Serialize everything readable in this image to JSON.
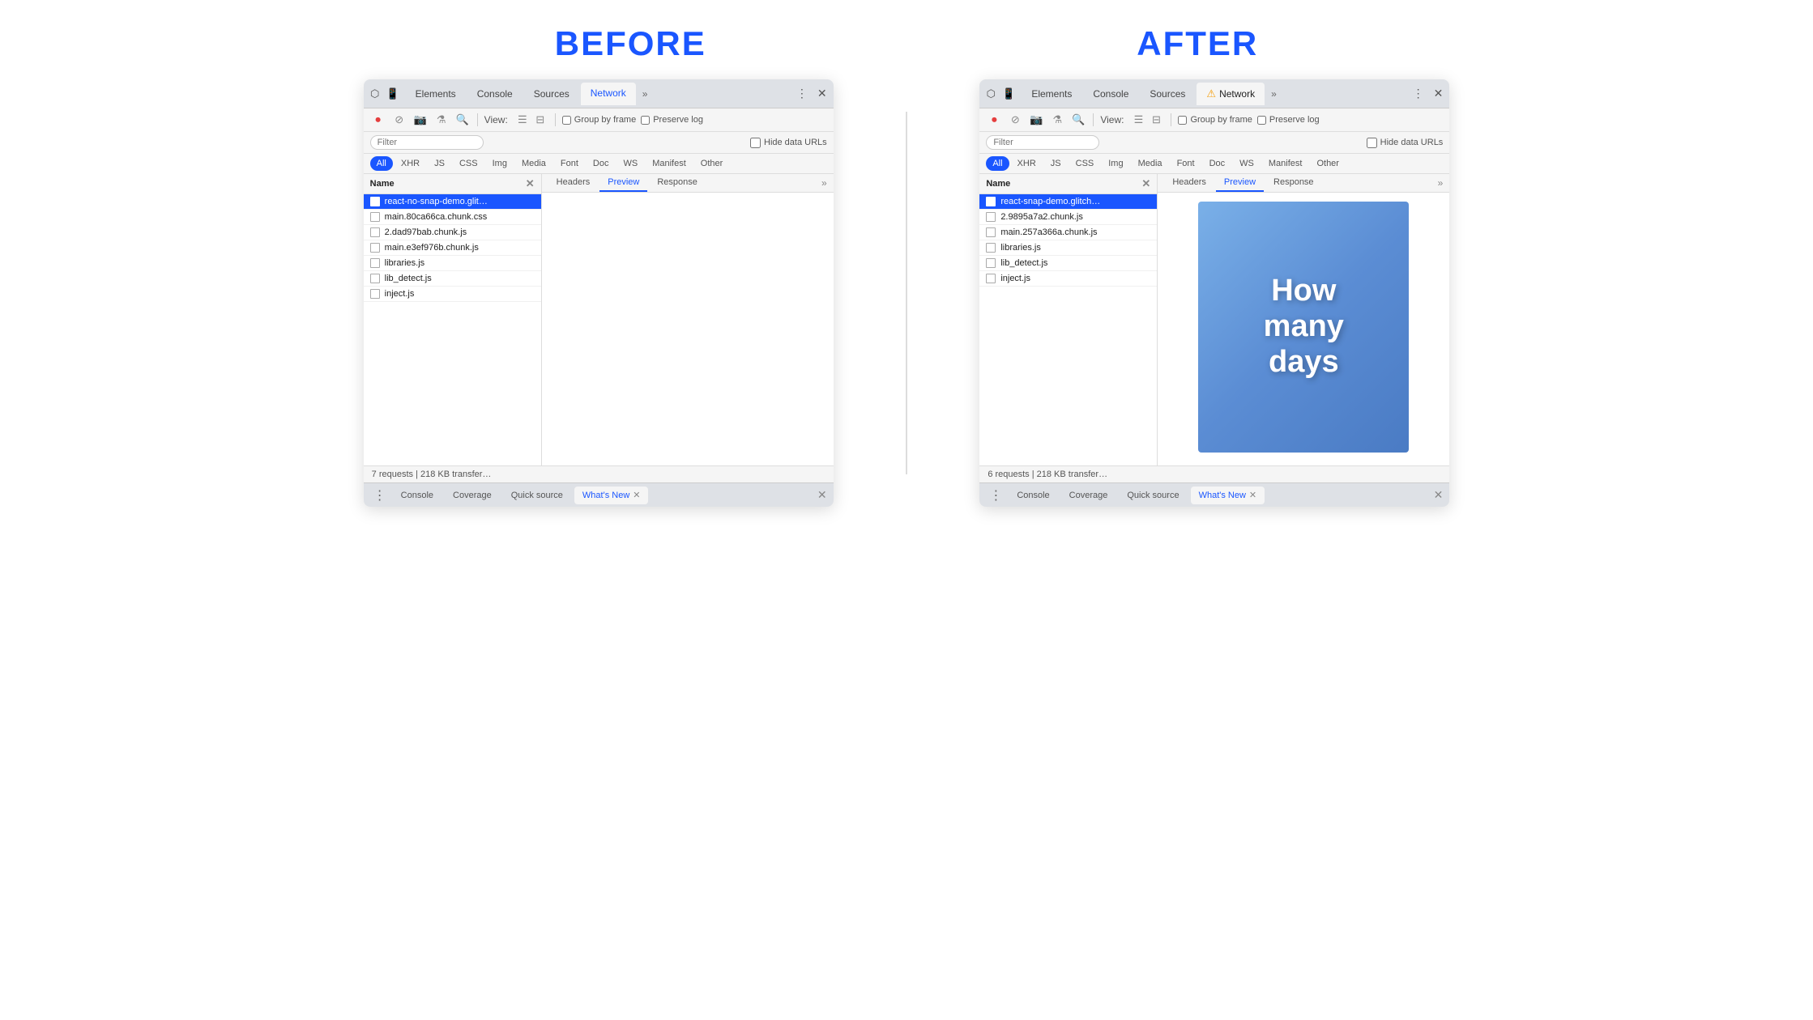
{
  "before_label": "BEFORE",
  "after_label": "AFTER",
  "before_panel": {
    "tabs": [
      {
        "id": "elements",
        "label": "Elements",
        "active": false
      },
      {
        "id": "console",
        "label": "Console",
        "active": false
      },
      {
        "id": "sources",
        "label": "Sources",
        "active": false
      },
      {
        "id": "network",
        "label": "Network",
        "active": true
      }
    ],
    "more_tabs": "»",
    "toolbar": {
      "view_label": "View:",
      "group_by_frame_label": "Group by frame",
      "preserve_log_label": "Preserve log"
    },
    "filter": {
      "placeholder": "Filter",
      "hide_data_urls_label": "Hide data URLs"
    },
    "type_filters": [
      "All",
      "XHR",
      "JS",
      "CSS",
      "Img",
      "Media",
      "Font",
      "Doc",
      "WS",
      "Manifest",
      "Other"
    ],
    "active_type": "All",
    "file_list_header": "Name",
    "files": [
      {
        "name": "react-no-snap-demo.glit…",
        "selected": true
      },
      {
        "name": "main.80ca66ca.chunk.css",
        "selected": false
      },
      {
        "name": "2.dad97bab.chunk.js",
        "selected": false
      },
      {
        "name": "main.e3ef976b.chunk.js",
        "selected": false
      },
      {
        "name": "libraries.js",
        "selected": false
      },
      {
        "name": "lib_detect.js",
        "selected": false
      },
      {
        "name": "inject.js",
        "selected": false
      }
    ],
    "preview_tabs": [
      "Headers",
      "Preview",
      "Response"
    ],
    "active_preview_tab": "Preview",
    "status": "7 requests | 218 KB transfer…",
    "bottom_tabs": [
      {
        "label": "Console",
        "active": false
      },
      {
        "label": "Coverage",
        "active": false
      },
      {
        "label": "Quick source",
        "active": false
      },
      {
        "label": "What's New",
        "active": true,
        "closable": true
      }
    ]
  },
  "after_panel": {
    "tabs": [
      {
        "id": "elements",
        "label": "Elements",
        "active": false
      },
      {
        "id": "console",
        "label": "Console",
        "active": false
      },
      {
        "id": "sources",
        "label": "Sources",
        "active": false
      },
      {
        "id": "network",
        "label": "Network",
        "active": true,
        "warning": true
      }
    ],
    "more_tabs": "»",
    "toolbar": {
      "view_label": "View:",
      "group_by_frame_label": "Group by frame",
      "preserve_log_label": "Preserve log"
    },
    "filter": {
      "placeholder": "Filter",
      "hide_data_urls_label": "Hide data URLs"
    },
    "type_filters": [
      "All",
      "XHR",
      "JS",
      "CSS",
      "Img",
      "Media",
      "Font",
      "Doc",
      "WS",
      "Manifest",
      "Other"
    ],
    "active_type": "All",
    "file_list_header": "Name",
    "files": [
      {
        "name": "react-snap-demo.glitch…",
        "selected": true
      },
      {
        "name": "2.9895a7a2.chunk.js",
        "selected": false
      },
      {
        "name": "main.257a366a.chunk.js",
        "selected": false
      },
      {
        "name": "libraries.js",
        "selected": false
      },
      {
        "name": "lib_detect.js",
        "selected": false
      },
      {
        "name": "inject.js",
        "selected": false
      }
    ],
    "preview_tabs": [
      "Headers",
      "Preview",
      "Response"
    ],
    "active_preview_tab": "Preview",
    "preview_image_text": "How\nmany\ndays",
    "status": "6 requests | 218 KB transfer…",
    "bottom_tabs": [
      {
        "label": "Console",
        "active": false
      },
      {
        "label": "Coverage",
        "active": false
      },
      {
        "label": "Quick source",
        "active": false
      },
      {
        "label": "What's New",
        "active": true,
        "closable": true
      }
    ]
  },
  "icons": {
    "cursor": "⬡",
    "inspect": "☰",
    "record_stop": "⏺",
    "no": "⊘",
    "video": "▶",
    "filter": "⚗",
    "search": "🔍",
    "more_vert": "⋮",
    "close": "✕",
    "view_list": "☰",
    "view_waterfall": "⊟"
  }
}
